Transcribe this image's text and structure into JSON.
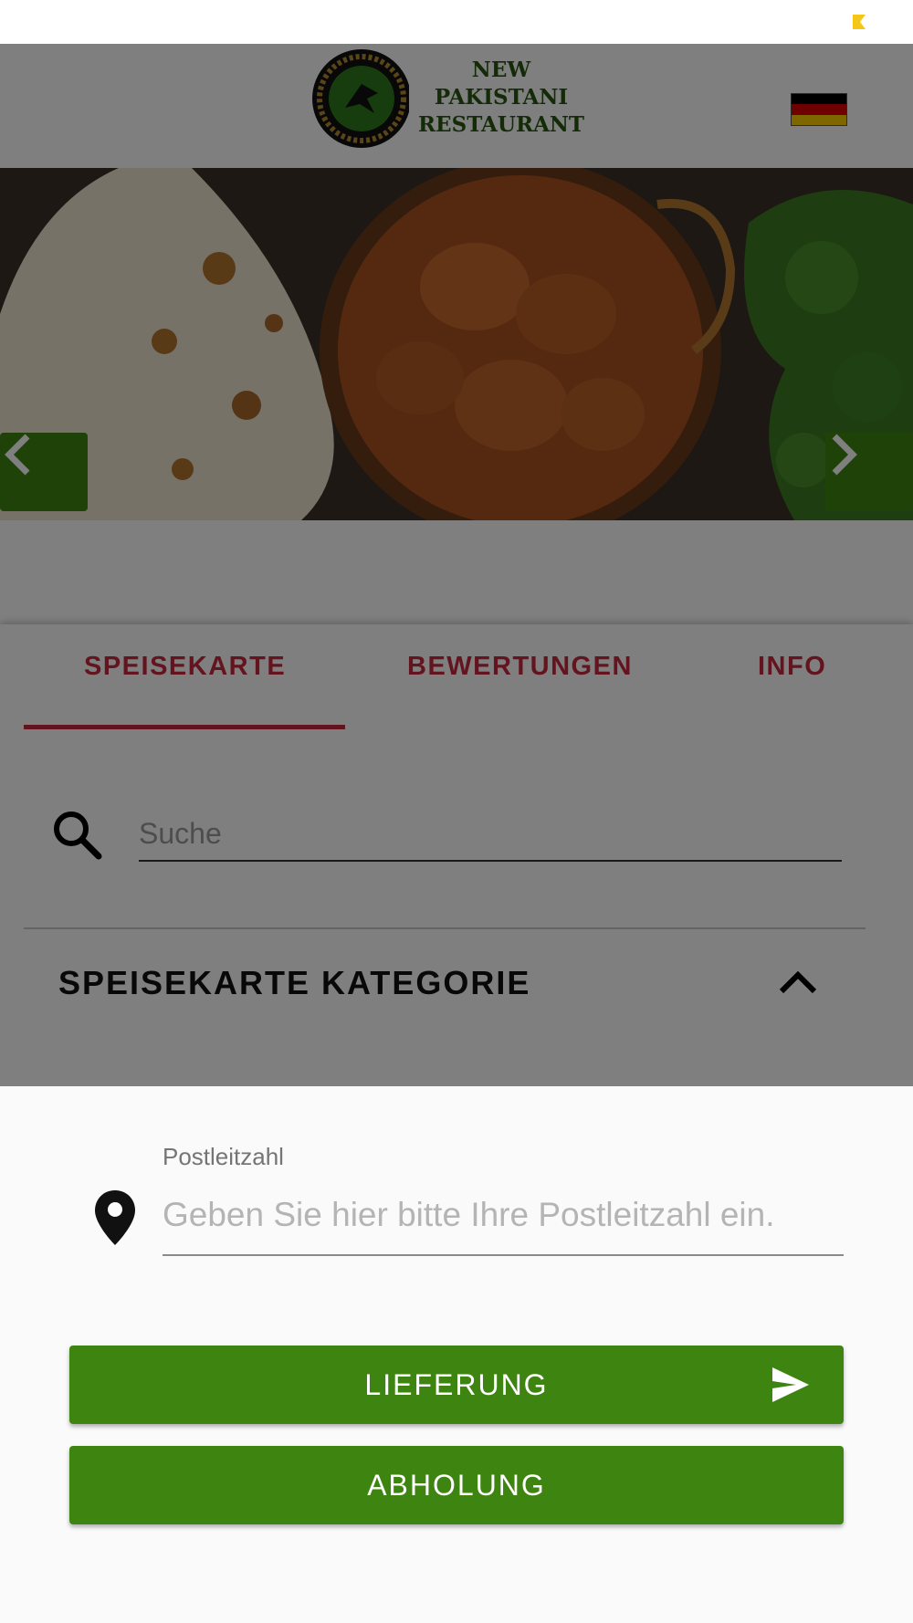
{
  "colors": {
    "primary_green": "#3e8410",
    "accent_red": "#c8283c",
    "status_icon_yellow": "#f5c518",
    "logo_green": "#27560f",
    "flag": [
      "#000000",
      "#dd0000",
      "#ffce00"
    ]
  },
  "status_bar": {
    "icon": "notification-icon"
  },
  "header": {
    "logo_lines": [
      "NEW",
      "PAKISTANI",
      "RESTAURANT"
    ],
    "language_flag": "german-flag-icon"
  },
  "carousel": {
    "prev_icon": "chevron-left-icon",
    "next_icon": "chevron-right-icon"
  },
  "tabs": [
    {
      "label": "SPEISEKARTE",
      "active": true
    },
    {
      "label": "BEWERTUNGEN",
      "active": false
    },
    {
      "label": "INFO",
      "active": false
    }
  ],
  "search": {
    "placeholder": "Suche",
    "value": "",
    "icon": "search-icon"
  },
  "menu_category": {
    "title": "SPEISEKARTE KATEGORIE",
    "icon": "chevron-up-icon",
    "expanded": true
  },
  "order_sheet": {
    "postcode_label": "Postleitzahl",
    "postcode_placeholder": "Geben Sie hier bitte Ihre Postleitzahl ein.",
    "postcode_value": "",
    "postcode_icon": "location-pin-icon",
    "delivery_label": "LIEFERUNG",
    "delivery_icon": "send-icon",
    "pickup_label": "ABHOLUNG"
  }
}
